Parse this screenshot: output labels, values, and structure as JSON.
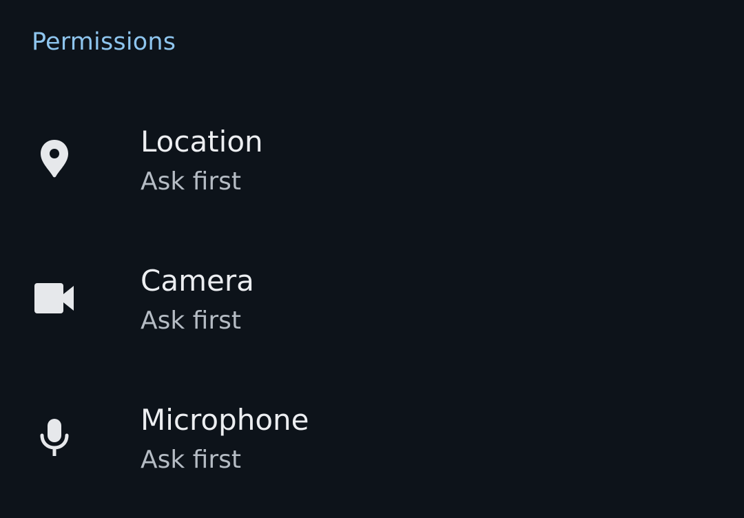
{
  "section": {
    "header": "Permissions"
  },
  "permissions": [
    {
      "label": "Location",
      "status": "Ask first",
      "icon": "location-pin-icon"
    },
    {
      "label": "Camera",
      "status": "Ask first",
      "icon": "video-camera-icon"
    },
    {
      "label": "Microphone",
      "status": "Ask first",
      "icon": "microphone-icon"
    }
  ],
  "colors": {
    "background": "#0d131a",
    "header": "#8ec5ee",
    "title": "#eceef1",
    "subtitle": "#b5bcc4",
    "icon": "#e6e8eb"
  }
}
